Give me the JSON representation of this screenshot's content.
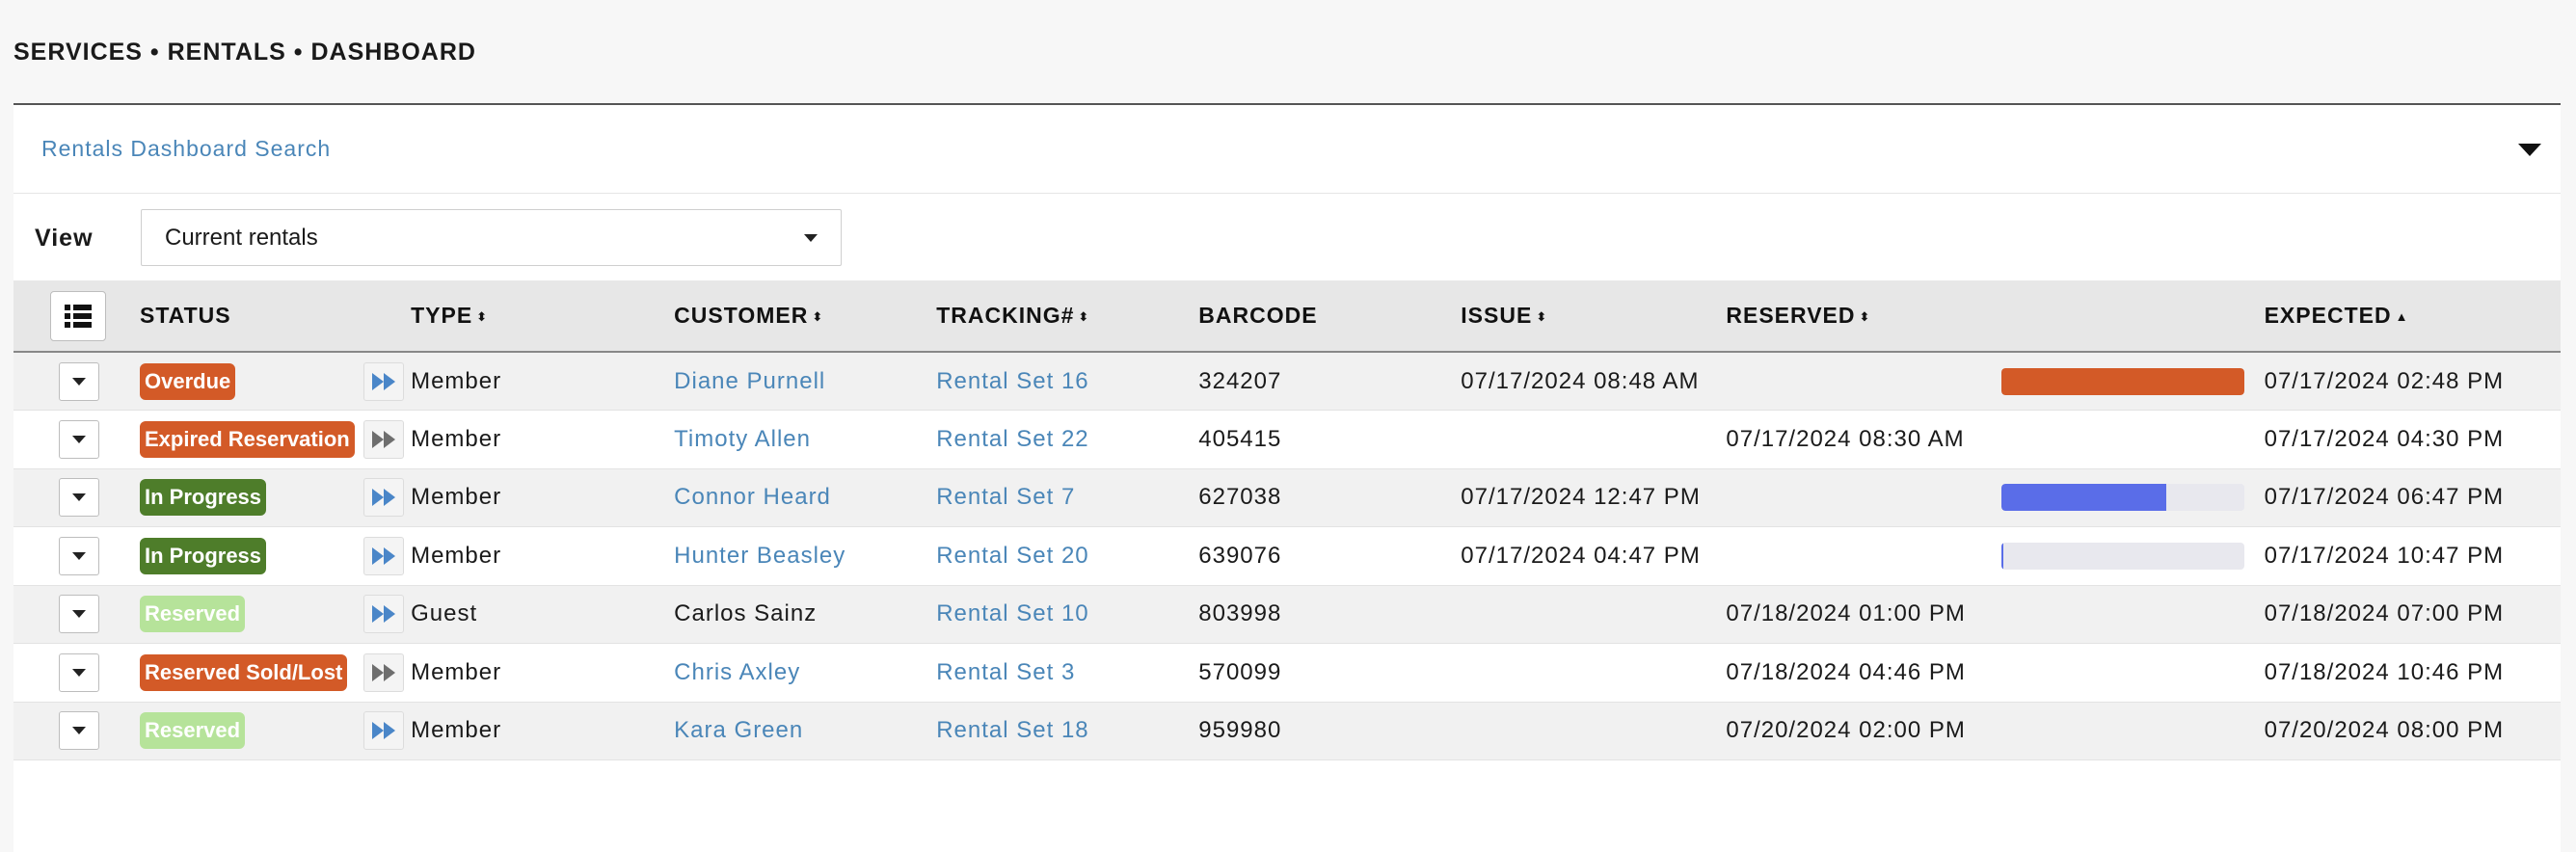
{
  "breadcrumb": "SERVICES • RENTALS • DASHBOARD",
  "search": {
    "title": "Rentals Dashboard Search"
  },
  "view": {
    "label": "View",
    "selected": "Current rentals"
  },
  "columns": {
    "status": "STATUS",
    "type": "TYPE",
    "customer": "CUSTOMER",
    "tracking": "TRACKING#",
    "barcode": "BARCODE",
    "issue": "ISSUE",
    "reserved": "RESERVED",
    "expected": "EXPECTED"
  },
  "colors": {
    "overdue": "#d35a27",
    "expired": "#d35a27",
    "in_progress": "#4e7d2a",
    "reserved": "#b6e39a",
    "sold_lost": "#d35a27",
    "ff_blue": "#4a86c8",
    "ff_gray": "#6e6e6e",
    "progress_blue": "#5a6de8"
  },
  "rows": [
    {
      "status": "Overdue",
      "status_kind": "overdue",
      "ff": "blue",
      "type": "Member",
      "customer": "Diane Purnell",
      "customer_link": true,
      "tracking": "Rental Set 16",
      "barcode": "324207",
      "issue": "07/17/2024 08:48 AM",
      "reserved": "",
      "progress": 1.0,
      "progress_color": "#d35a27",
      "expected": "07/17/2024 02:48 PM"
    },
    {
      "status": "Expired Reservation",
      "status_kind": "expired",
      "ff": "gray",
      "type": "Member",
      "customer": "Timoty Allen",
      "customer_link": true,
      "tracking": "Rental Set 22",
      "barcode": "405415",
      "issue": "",
      "reserved": "07/17/2024 08:30 AM",
      "progress": null,
      "expected": "07/17/2024 04:30 PM"
    },
    {
      "status": "In Progress",
      "status_kind": "in_progress",
      "ff": "blue",
      "type": "Member",
      "customer": "Connor Heard",
      "customer_link": true,
      "tracking": "Rental Set 7",
      "barcode": "627038",
      "issue": "07/17/2024 12:47 PM",
      "reserved": "",
      "progress": 0.68,
      "progress_color": "#5a6de8",
      "expected": "07/17/2024 06:47 PM"
    },
    {
      "status": "In Progress",
      "status_kind": "in_progress",
      "ff": "blue",
      "type": "Member",
      "customer": "Hunter Beasley",
      "customer_link": true,
      "tracking": "Rental Set 20",
      "barcode": "639076",
      "issue": "07/17/2024 04:47 PM",
      "reserved": "",
      "progress": 0.01,
      "progress_color": "#5a6de8",
      "expected": "07/17/2024 10:47 PM"
    },
    {
      "status": "Reserved",
      "status_kind": "reserved",
      "ff": "blue",
      "type": "Guest",
      "customer": "Carlos Sainz",
      "customer_link": false,
      "tracking": "Rental Set 10",
      "barcode": "803998",
      "issue": "",
      "reserved": "07/18/2024 01:00 PM",
      "progress": null,
      "expected": "07/18/2024 07:00 PM"
    },
    {
      "status": "Reserved Sold/Lost",
      "status_kind": "sold_lost",
      "ff": "gray",
      "type": "Member",
      "customer": "Chris Axley",
      "customer_link": true,
      "tracking": "Rental Set 3",
      "barcode": "570099",
      "issue": "",
      "reserved": "07/18/2024 04:46 PM",
      "progress": null,
      "expected": "07/18/2024 10:46 PM"
    },
    {
      "status": "Reserved",
      "status_kind": "reserved",
      "ff": "blue",
      "type": "Member",
      "customer": "Kara Green",
      "customer_link": true,
      "tracking": "Rental Set 18",
      "barcode": "959980",
      "issue": "",
      "reserved": "07/20/2024 02:00 PM",
      "progress": null,
      "expected": "07/20/2024 08:00 PM"
    }
  ]
}
